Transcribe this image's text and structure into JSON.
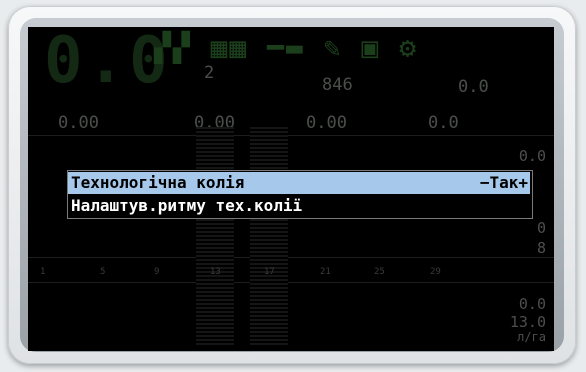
{
  "status": {
    "big_speed": "0.0",
    "icons": [
      "field-icon",
      "field-icon",
      "implement-icon",
      "implement-icon",
      "tractor-icon",
      "tractor-icon",
      "wrench-icon",
      "doc-icon",
      "settings-icon"
    ],
    "row1": {
      "sections": "2",
      "area": "846",
      "rpm": "0.0"
    },
    "row2": {
      "v1": "0.00",
      "v2": "0.00",
      "v3": "0.00",
      "v4": "0.0"
    },
    "right": {
      "r1": "0.0",
      "r2": "0",
      "r3": "8",
      "r4": "0.0",
      "r5": "13.0",
      "unit": "л/га"
    }
  },
  "menu": {
    "items": [
      {
        "label": "Технологічна колія",
        "value": "−Так+",
        "selected": true
      },
      {
        "label": "Налаштув.ритму тех.колії",
        "value": "",
        "selected": false
      }
    ]
  },
  "bottom_ticks": [
    "1",
    "5",
    "9",
    "13",
    "17",
    "21",
    "25",
    "29"
  ]
}
